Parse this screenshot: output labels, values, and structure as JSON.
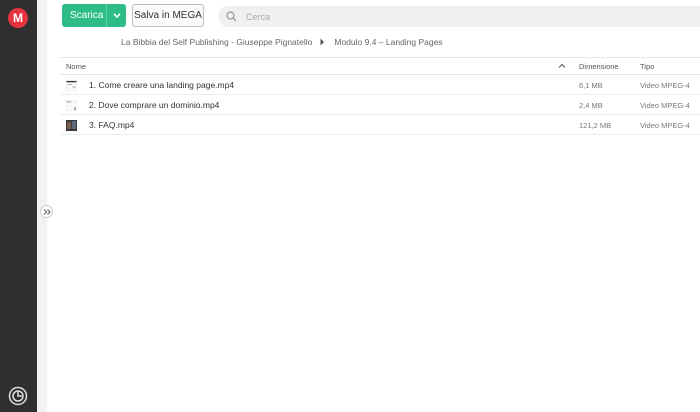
{
  "app": {
    "logo_letter": "M"
  },
  "toolbar": {
    "download_label": "Scarica",
    "save_label": "Salva in MEGA",
    "search_placeholder": "Cerca",
    "accent_color": "#2ebd87"
  },
  "breadcrumb": {
    "items": [
      "La Bibbia del Self Publishing - Giuseppe Pignatello",
      "Modulo 9.4 – Landing Pages"
    ]
  },
  "table": {
    "headers": {
      "name": "Nome",
      "size": "Dimensione",
      "type": "Tipo"
    },
    "rows": [
      {
        "name": "1. Come creare una landing page.mp4",
        "size": "6,1 MB",
        "type": "Video MPEG-4",
        "thumb": "light-slide-thumbnail"
      },
      {
        "name": "2. Dove comprare un dominio.mp4",
        "size": "2,4 MB",
        "type": "Video MPEG-4",
        "thumb": "light-slide-thumbnail"
      },
      {
        "name": "3. FAQ.mp4",
        "size": "121,2 MB",
        "type": "Video MPEG-4",
        "thumb": "dark-video-thumbnail"
      }
    ]
  },
  "icons": {
    "logo": "mega-logo-icon",
    "search": "search-icon",
    "dropdown": "chevron-down-icon",
    "breadcrumb_separator": "chevron-right-icon",
    "sort": "sort-up-icon",
    "expand": "expand-sidebar-icon",
    "bottom": "transfer-manager-icon"
  }
}
